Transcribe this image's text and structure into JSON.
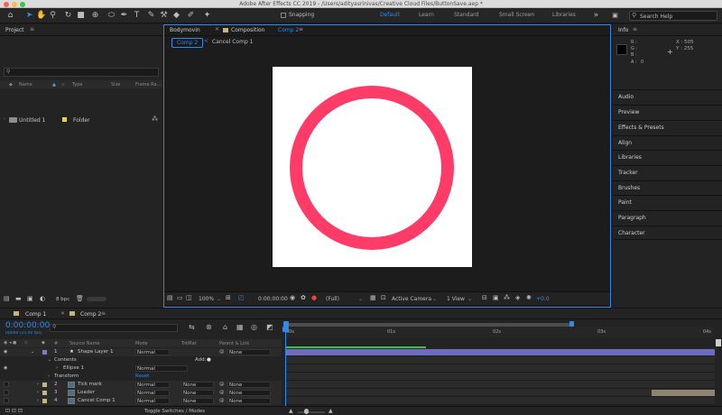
{
  "window": {
    "title": "Adobe After Effects CC 2019 - /Users/adityasrinivas/Creative Cloud Files/ButtonSave.aep *"
  },
  "toolbar": {
    "snapping_label": "Snapping",
    "workspaces": [
      "Default",
      "Learn",
      "Standard",
      "Small Screen",
      "Libraries"
    ],
    "active_workspace": "Default",
    "search_placeholder": "Search Help"
  },
  "project_panel": {
    "title": "Project",
    "columns": [
      "Name",
      "Type",
      "Size",
      "Frame Ra..."
    ],
    "items": [
      {
        "name": "Untitled 1",
        "type": "Folder"
      }
    ],
    "bpc": "8 bpc"
  },
  "composition_panel": {
    "tabs": [
      "Bodymovin",
      "Composition Comp 2"
    ],
    "tab_prefix": "Composition",
    "tab_comp": "Comp 2",
    "breadcrumbs": [
      "Comp 2",
      "Cancel Comp 1"
    ],
    "zoom": "100%",
    "timecode": "0:00:00:00",
    "resolution": "(Full)",
    "camera": "Active Camera",
    "view": "1 View",
    "exposure": "+0.0",
    "ring_color": "#ff3b67",
    "canvas_color": "#ffffff"
  },
  "right_panel": {
    "info_title": "Info",
    "rgba_labels": [
      "R :",
      "G :",
      "B :",
      "A :"
    ],
    "alpha_value": "0",
    "x_readout": "X : 505",
    "y_readout": "Y : 255",
    "sections": [
      "Audio",
      "Preview",
      "Effects & Presets",
      "Align",
      "Libraries",
      "Tracker",
      "Brushes",
      "Paint",
      "Paragraph",
      "Character"
    ]
  },
  "timeline": {
    "tabs": [
      "Comp 1",
      "Comp 2"
    ],
    "active_tab": "Comp 2",
    "current_time": "0:00:00:00",
    "fps": "00000 (25.00 fps)",
    "columns": [
      "#",
      "Source Name",
      "Mode",
      "TrkMat",
      "Parent & Link"
    ],
    "ruler": [
      "00s",
      "01s",
      "02s",
      "03s",
      "04s"
    ],
    "layers": [
      {
        "num": "1",
        "name": "Shape Layer 1",
        "mode": "Normal",
        "trkmat": "",
        "parent": "None",
        "color": "#7a78d8"
      },
      {
        "num": "",
        "name": "Contents",
        "mode": "",
        "trkmat": "",
        "parent": "",
        "add_label": "Add:"
      },
      {
        "num": "",
        "name": "Ellipse 1",
        "mode": "Normal",
        "trkmat": "",
        "parent": ""
      },
      {
        "num": "",
        "name": "Transform",
        "mode": "",
        "trkmat": "",
        "parent": "",
        "reset_label": "Reset"
      },
      {
        "num": "2",
        "name": "Tick mark",
        "mode": "Normal",
        "trkmat": "None",
        "parent": "None",
        "color": "#c8b37a"
      },
      {
        "num": "3",
        "name": "Loader",
        "mode": "Normal",
        "trkmat": "None",
        "parent": "None",
        "color": "#c8b37a"
      },
      {
        "num": "4",
        "name": "Cancel Comp 1",
        "mode": "Normal",
        "trkmat": "None",
        "parent": "None",
        "color": "#c8b37a"
      }
    ],
    "footer_label": "Toggle Switches / Modes",
    "accent": "#2d8ceb"
  }
}
